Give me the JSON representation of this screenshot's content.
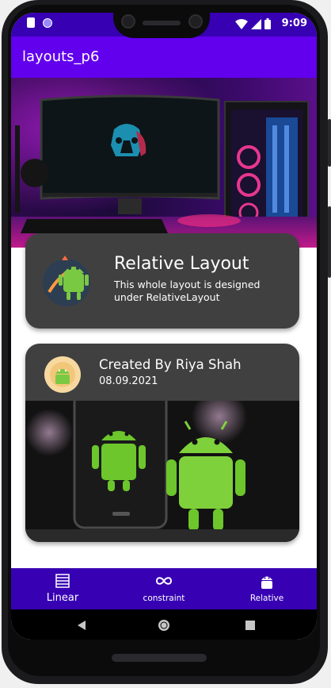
{
  "status_bar": {
    "time": "9:09"
  },
  "app_bar": {
    "title": "layouts_p6"
  },
  "relative_card": {
    "title": "Relative Layout",
    "description": "This whole layout is designed under RelativeLayout",
    "icon": "android-rocket-icon"
  },
  "creator_card": {
    "name": "Created By Riya Shah",
    "date": "08.09.2021",
    "avatar_icon": "android-avatar-icon",
    "image": "android-robots-photo"
  },
  "bottom_nav": {
    "items": [
      {
        "label": "Linear",
        "icon": "linear-layout-icon"
      },
      {
        "label": "constraint",
        "icon": "infinity-icon"
      },
      {
        "label": "Relative",
        "icon": "android-icon"
      }
    ]
  },
  "colors": {
    "primary": "#6200ee",
    "primary_dark": "#3700b3",
    "card_bg": "#404040"
  }
}
